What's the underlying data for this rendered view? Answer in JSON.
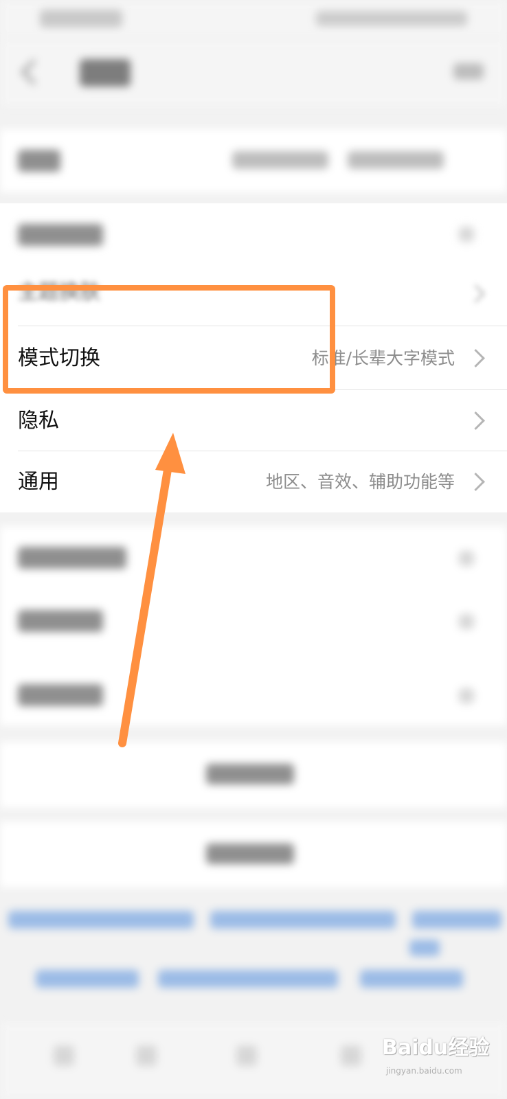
{
  "settings": {
    "rows": [
      {
        "label": "主题换肤",
        "value": ""
      },
      {
        "label": "模式切换",
        "value": "标准/长辈大字模式"
      },
      {
        "label": "隐私",
        "value": ""
      },
      {
        "label": "通用",
        "value": "地区、音效、辅助功能等"
      }
    ]
  },
  "watermark": {
    "brand": "Baidu经验",
    "url": "jingyan.baidu.com"
  },
  "colors": {
    "highlight": "#ff9040",
    "background": "#f2f2f2",
    "card": "#ffffff",
    "value_text": "#8c8c8c"
  }
}
